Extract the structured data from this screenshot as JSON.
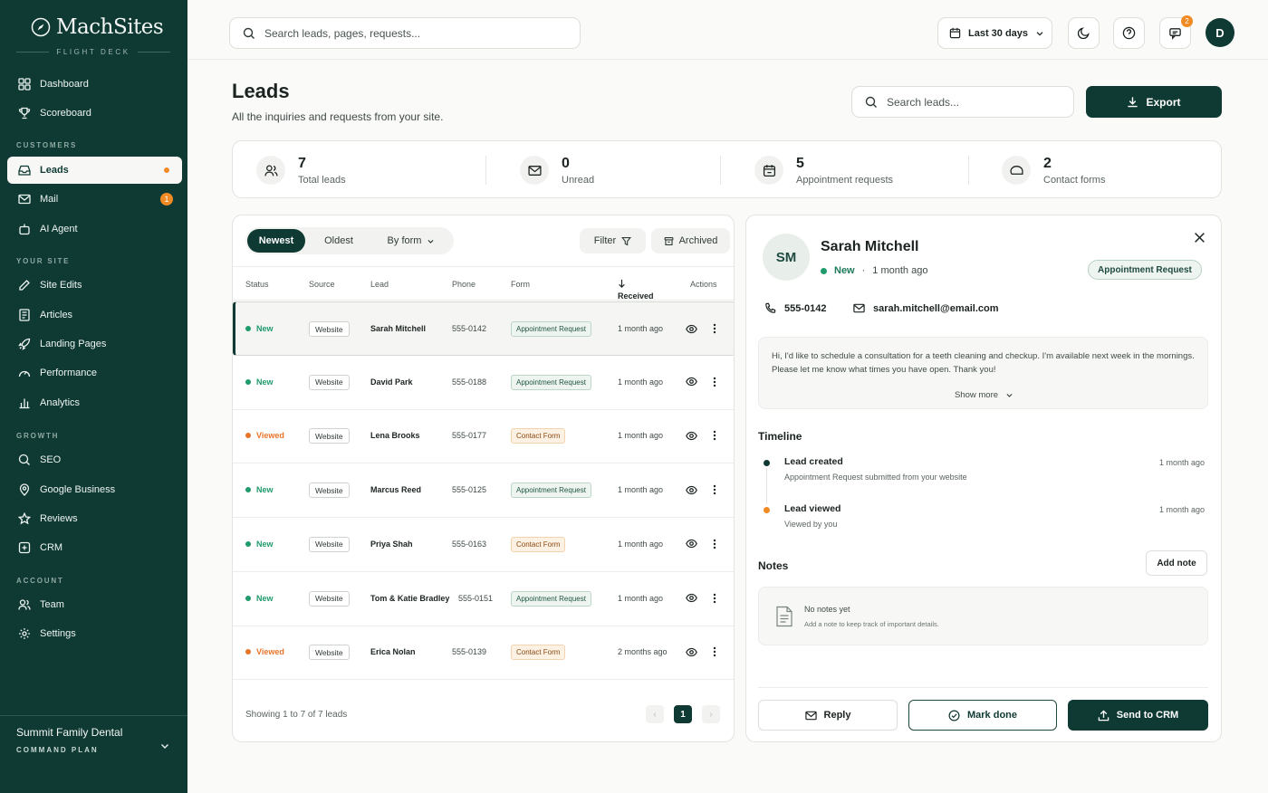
{
  "brand": {
    "name": "MachSites",
    "subtitle": "FLIGHT DECK"
  },
  "sidebar": {
    "top_items": [
      {
        "label": "Dashboard",
        "icon": "grid-icon"
      },
      {
        "label": "Scoreboard",
        "icon": "trophy-icon"
      }
    ],
    "sections": [
      {
        "title": "CUSTOMERS",
        "items": [
          {
            "label": "Leads",
            "icon": "inbox-icon"
          },
          {
            "label": "Mail",
            "icon": "mail-icon",
            "count": "1"
          },
          {
            "label": "AI Agent",
            "icon": "bot-icon"
          }
        ]
      },
      {
        "title": "YOUR SITE",
        "items": [
          {
            "label": "Site Edits",
            "icon": "pencil-icon"
          },
          {
            "label": "Articles",
            "icon": "article-icon"
          },
          {
            "label": "Landing Pages",
            "icon": "rocket-icon"
          },
          {
            "label": "Performance",
            "icon": "gauge-icon"
          },
          {
            "label": "Analytics",
            "icon": "bar-chart-icon"
          }
        ]
      },
      {
        "title": "GROWTH",
        "items": [
          {
            "label": "SEO",
            "icon": "search-icon"
          },
          {
            "label": "Google Business",
            "icon": "map-pin-icon"
          },
          {
            "label": "Reviews",
            "icon": "star-icon"
          },
          {
            "label": "CRM",
            "icon": "crm-icon"
          }
        ]
      },
      {
        "title": "ACCOUNT",
        "items": [
          {
            "label": "Team",
            "icon": "users-icon"
          },
          {
            "label": "Settings",
            "icon": "gear-icon"
          }
        ]
      }
    ],
    "workspace": {
      "name": "Summit Family Dental",
      "plan": "COMMAND PLAN"
    }
  },
  "topbar": {
    "search_placeholder": "Search leads, pages, requests...",
    "date_range": "Last 30 days",
    "notification_count": "2",
    "user_initial": "D"
  },
  "page": {
    "title": "Leads",
    "subtitle": "All the inquiries and requests from your site.",
    "search_placeholder": "Search leads...",
    "export_label": "Export"
  },
  "stats": [
    {
      "value": "7",
      "label": "Total leads",
      "icon": "users-icon"
    },
    {
      "value": "0",
      "label": "Unread",
      "icon": "mail-icon"
    },
    {
      "value": "5",
      "label": "Appointment requests",
      "icon": "calendar-icon"
    },
    {
      "value": "2",
      "label": "Contact forms",
      "icon": "chat-bubble-icon"
    }
  ],
  "table": {
    "sort_tabs": [
      "Newest",
      "Oldest",
      "By form"
    ],
    "filter_label": "Filter",
    "archived_label": "Archived",
    "columns": {
      "status": "Status",
      "source": "Source",
      "lead": "Lead",
      "phone": "Phone",
      "form": "Form",
      "received": "Received",
      "actions": "Actions"
    },
    "rows": [
      {
        "status": "New",
        "source": "Website",
        "lead": "Sarah Mitchell",
        "phone": "555-0142",
        "form": "Appointment Request",
        "received": "1 month ago"
      },
      {
        "status": "New",
        "source": "Website",
        "lead": "David Park",
        "phone": "555-0188",
        "form": "Appointment Request",
        "received": "1 month ago"
      },
      {
        "status": "Viewed",
        "source": "Website",
        "lead": "Lena Brooks",
        "phone": "555-0177",
        "form": "Contact Form",
        "received": "1 month ago"
      },
      {
        "status": "New",
        "source": "Website",
        "lead": "Marcus Reed",
        "phone": "555-0125",
        "form": "Appointment Request",
        "received": "1 month ago"
      },
      {
        "status": "New",
        "source": "Website",
        "lead": "Priya Shah",
        "phone": "555-0163",
        "form": "Contact Form",
        "received": "1 month ago"
      },
      {
        "status": "New",
        "source": "Website",
        "lead": "Tom & Katie Bradley",
        "phone": "555-0151",
        "form": "Appointment Request",
        "received": "1 month ago"
      },
      {
        "status": "Viewed",
        "source": "Website",
        "lead": "Erica Nolan",
        "phone": "555-0139",
        "form": "Contact Form",
        "received": "2 months ago"
      }
    ],
    "footer": "Showing 1 to 7 of 7 leads",
    "current_page": "1"
  },
  "detail": {
    "initials": "SM",
    "name": "Sarah Mitchell",
    "status": "New",
    "time": "1 month ago",
    "form_pill": "Appointment Request",
    "phone": "555-0142",
    "email": "sarah.mitchell@email.com",
    "message": "Hi, I'd like to schedule a consultation for a teeth cleaning and checkup. I'm available next week in the mornings. Please let me know what times you have open. Thank you!",
    "show_more": "Show more",
    "timeline_title": "Timeline",
    "timeline": [
      {
        "title": "Lead created",
        "sub": "Appointment Request submitted from your website",
        "when": "1 month ago"
      },
      {
        "title": "Lead viewed",
        "sub": "Viewed by you",
        "when": "1 month ago"
      }
    ],
    "notes_title": "Notes",
    "add_note": "Add note",
    "no_notes": "No notes yet",
    "no_notes_sub": "Add a note to keep track of important details.",
    "actions": {
      "reply": "Reply",
      "mark_done": "Mark done",
      "send_crm": "Send to CRM"
    }
  },
  "colors": {
    "brand": "#0f3a33",
    "accent": "#f08a24",
    "new": "#1e9a6b",
    "viewed": "#e8742a"
  }
}
